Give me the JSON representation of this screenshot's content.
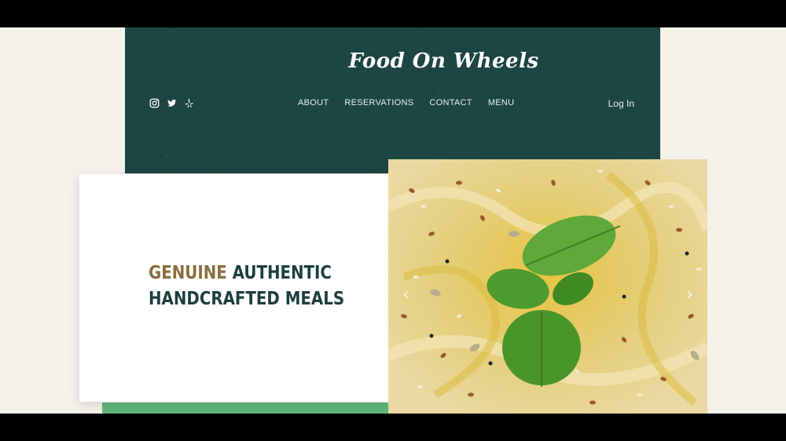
{
  "header": {
    "logo_text": "Food On Wheels",
    "background_color": "#1c4543",
    "social_icons": [
      "instagram-icon",
      "twitter-icon",
      "yelp-icon"
    ],
    "nav": [
      {
        "label": "ABOUT"
      },
      {
        "label": "RESERVATIONS"
      },
      {
        "label": "CONTACT"
      },
      {
        "label": "MENU"
      }
    ],
    "login_label": "Log In"
  },
  "hero": {
    "headline_accent": "GENUINE",
    "headline_rest": " AUTHENTIC",
    "headline_line2": "HANDCRAFTED MEALS",
    "accent_color": "#8a6f3e",
    "text_color": "#1c3f3d"
  },
  "slider": {
    "image_subject": "hummus with olive oil, seeds and basil",
    "prev_icon": "chevron-left-icon",
    "next_icon": "chevron-right-icon",
    "prev_arrow": "‹",
    "next_arrow": "›"
  }
}
